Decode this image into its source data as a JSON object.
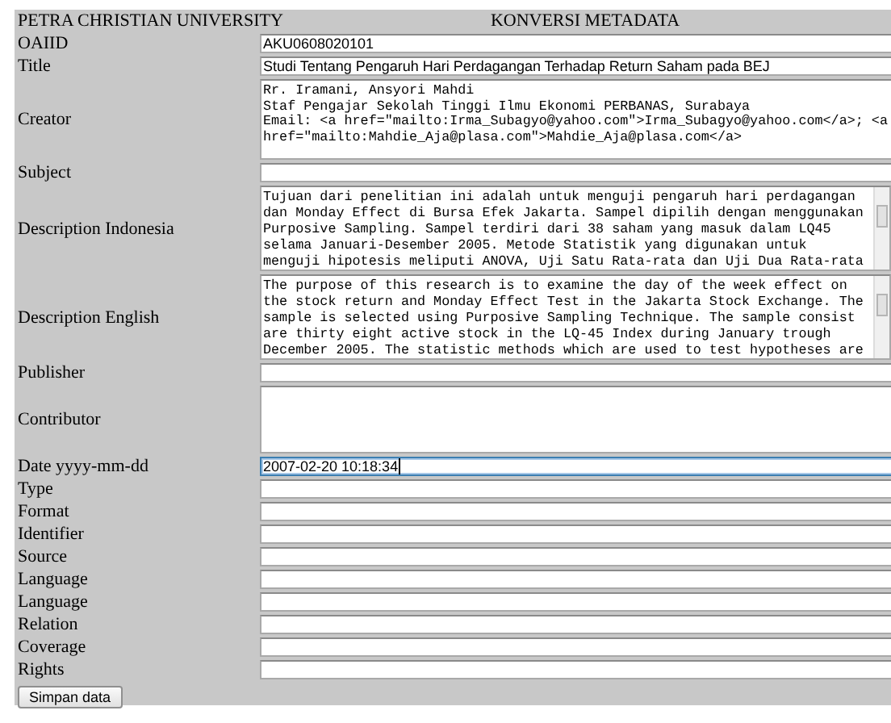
{
  "header": {
    "org": "PETRA CHRISTIAN UNIVERSITY",
    "title": "KONVERSI METADATA"
  },
  "rows": [
    {
      "label": "OAIID",
      "kind": "text",
      "value": "AKU0608020101",
      "focused": false
    },
    {
      "label": "Title",
      "kind": "text",
      "value": "Studi Tentang Pengaruh Hari Perdagangan Terhadap Return Saham pada BEJ",
      "focused": false
    },
    {
      "label": "Creator",
      "kind": "textarea",
      "lines": [
        "Rr. Iramani, Ansyori Mahdi",
        "Staf Pengajar Sekolah Tinggi Ilmu Ekonomi PERBANAS, Surabaya",
        "Email: <a href=\"mailto:Irma_Subagyo@yahoo.com\">Irma_Subagyo@yahoo.com</a>; <a",
        "href=\"mailto:Mahdie_Aja@plasa.com\">Mahdie_Aja@plasa.com</a>"
      ],
      "focused": false
    },
    {
      "label": "Subject",
      "kind": "text",
      "focused": false
    },
    {
      "label": "Description Indonesia",
      "kind": "scrolled",
      "lines": [
        "Tujuan dari penelitian ini adalah untuk menguji pengaruh hari perdagangan",
        "dan Monday Effect di Bursa Efek Jakarta. Sampel dipilih dengan menggunakan",
        "Purposive Sampling. Sampel terdiri dari 38 saham yang masuk dalam LQ45",
        "selama Januari-Desember 2005. Metode Statistik yang digunakan untuk",
        "menguji hipotesis meliputi ANOVA, Uji Satu Rata-rata dan Uji Dua Rata-rata"
      ],
      "focused": false
    },
    {
      "label": "Description English",
      "kind": "scrolled",
      "lines": [
        "The purpose of this research is to examine the day of the week effect on",
        "the stock return and Monday Effect Test in the Jakarta Stock Exchange. The",
        "sample is selected using Purposive Sampling Technique. The sample consist",
        "are thirty eight active stock in the LQ-45 Index during January trough",
        "December 2005. The statistic methods which are used to test hypotheses are"
      ],
      "focused": false
    },
    {
      "label": "Publisher",
      "kind": "text",
      "focused": false
    },
    {
      "label": "Contributor",
      "kind": "textarea",
      "focused": false
    },
    {
      "label": "Date yyyy-mm-dd",
      "kind": "text",
      "value": "2007-02-20 10:18:34",
      "focused": true
    },
    {
      "label": "Type",
      "kind": "text",
      "focused": false
    },
    {
      "label": "Format",
      "kind": "text",
      "focused": false
    },
    {
      "label": "Identifier",
      "kind": "text",
      "focused": false
    },
    {
      "label": "Source",
      "kind": "text",
      "focused": false
    },
    {
      "label": "Language",
      "kind": "text",
      "focused": false
    },
    {
      "label": "Language",
      "kind": "text",
      "focused": false
    },
    {
      "label": "Relation",
      "kind": "text",
      "focused": false
    },
    {
      "label": "Coverage",
      "kind": "text",
      "focused": false
    },
    {
      "label": "Rights",
      "kind": "text",
      "focused": false
    }
  ],
  "submit": "Simpan data"
}
